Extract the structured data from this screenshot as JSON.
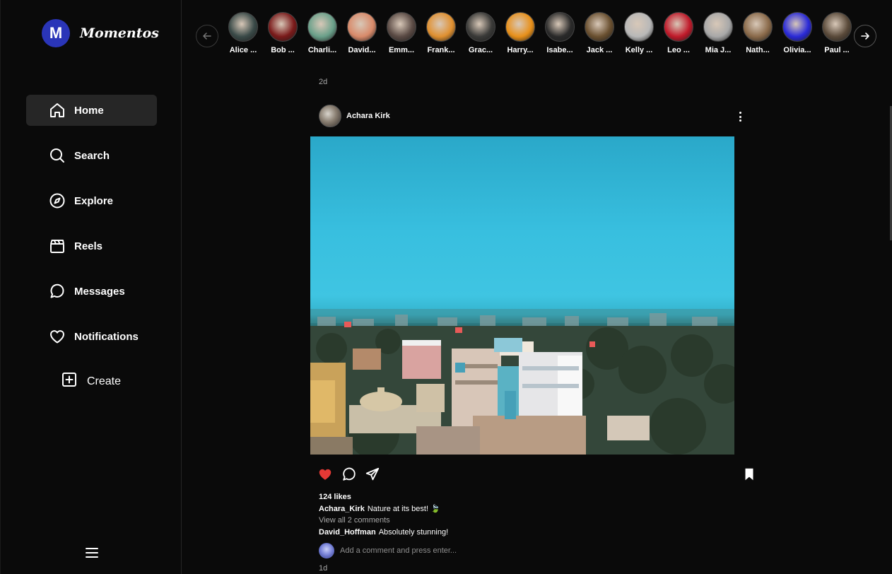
{
  "brand": {
    "logo_letter": "M",
    "name": "Momentos",
    "color": "#2a35b8"
  },
  "nav": {
    "home": "Home",
    "search": "Search",
    "explore": "Explore",
    "reels": "Reels",
    "messages": "Messages",
    "notifications": "Notifications",
    "create": "Create"
  },
  "stories": [
    {
      "name": "Alice ...",
      "color": "#3a4a48"
    },
    {
      "name": "Bob ...",
      "color": "#7a1a1a"
    },
    {
      "name": "Charli...",
      "color": "#6aa08a"
    },
    {
      "name": "David...",
      "color": "#d88a6a"
    },
    {
      "name": "Emm...",
      "color": "#5a4a44"
    },
    {
      "name": "Frank...",
      "color": "#e09030"
    },
    {
      "name": "Grac...",
      "color": "#3a3a38"
    },
    {
      "name": "Harry...",
      "color": "#e8901a"
    },
    {
      "name": "Isabe...",
      "color": "#2a2a2a"
    },
    {
      "name": "Jack ...",
      "color": "#6a5030"
    },
    {
      "name": "Kelly ...",
      "color": "#b8b8b8"
    },
    {
      "name": "Leo ...",
      "color": "#c01a2a"
    },
    {
      "name": "Mia J...",
      "color": "#a8a8a8"
    },
    {
      "name": "Nath...",
      "color": "#8a6a4a"
    },
    {
      "name": "Olivia...",
      "color": "#2a2ad8"
    },
    {
      "name": "Paul ...",
      "color": "#5a4a3a"
    }
  ],
  "feed": {
    "prev_post_time": "2d",
    "post": {
      "username": "Achara Kirk",
      "likes": "124 likes",
      "caption_user": "Achara_Kirk",
      "caption_text": "Nature at its best! 🍃",
      "view_all": "View all 2 comments",
      "comment_user": "David_Hoffman",
      "comment_text": "Absolutely stunning!",
      "comment_placeholder": "Add a comment and press enter...",
      "liked": true,
      "like_color": "#e53935",
      "saved": true
    },
    "next_post_time": "1d"
  }
}
